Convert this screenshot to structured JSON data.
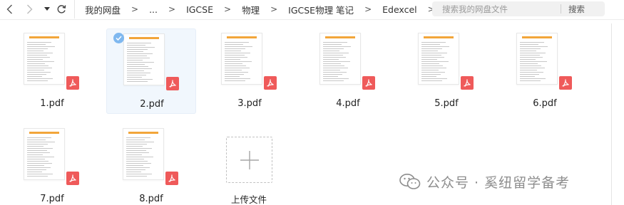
{
  "breadcrumb": [
    "我的网盘",
    "...",
    "IGCSE",
    "物理",
    "IGCSE物理 笔记",
    "Edexcel"
  ],
  "breadcrumb_separator": ">",
  "search": {
    "placeholder": "搜索我的网盘文件",
    "button": "搜索"
  },
  "files": [
    {
      "name": "1.pdf",
      "selected": false
    },
    {
      "name": "2.pdf",
      "selected": true
    },
    {
      "name": "3.pdf",
      "selected": false
    },
    {
      "name": "4.pdf",
      "selected": false
    },
    {
      "name": "5.pdf",
      "selected": false
    },
    {
      "name": "6.pdf",
      "selected": false
    },
    {
      "name": "7.pdf",
      "selected": false
    },
    {
      "name": "8.pdf",
      "selected": false
    }
  ],
  "upload": {
    "label": "上传文件"
  },
  "watermark": {
    "text": "公众号 · 奚纽留学备考"
  },
  "colors": {
    "accent": "#7fb8ef",
    "pdf_badge": "#ef5a5a",
    "thumb_header": "#f2a53a"
  },
  "icons": [
    "back-arrow-icon",
    "forward-arrow-icon",
    "dropdown-caret-icon",
    "refresh-icon",
    "pdf-icon",
    "check-icon",
    "plus-icon",
    "wechat-icon"
  ]
}
